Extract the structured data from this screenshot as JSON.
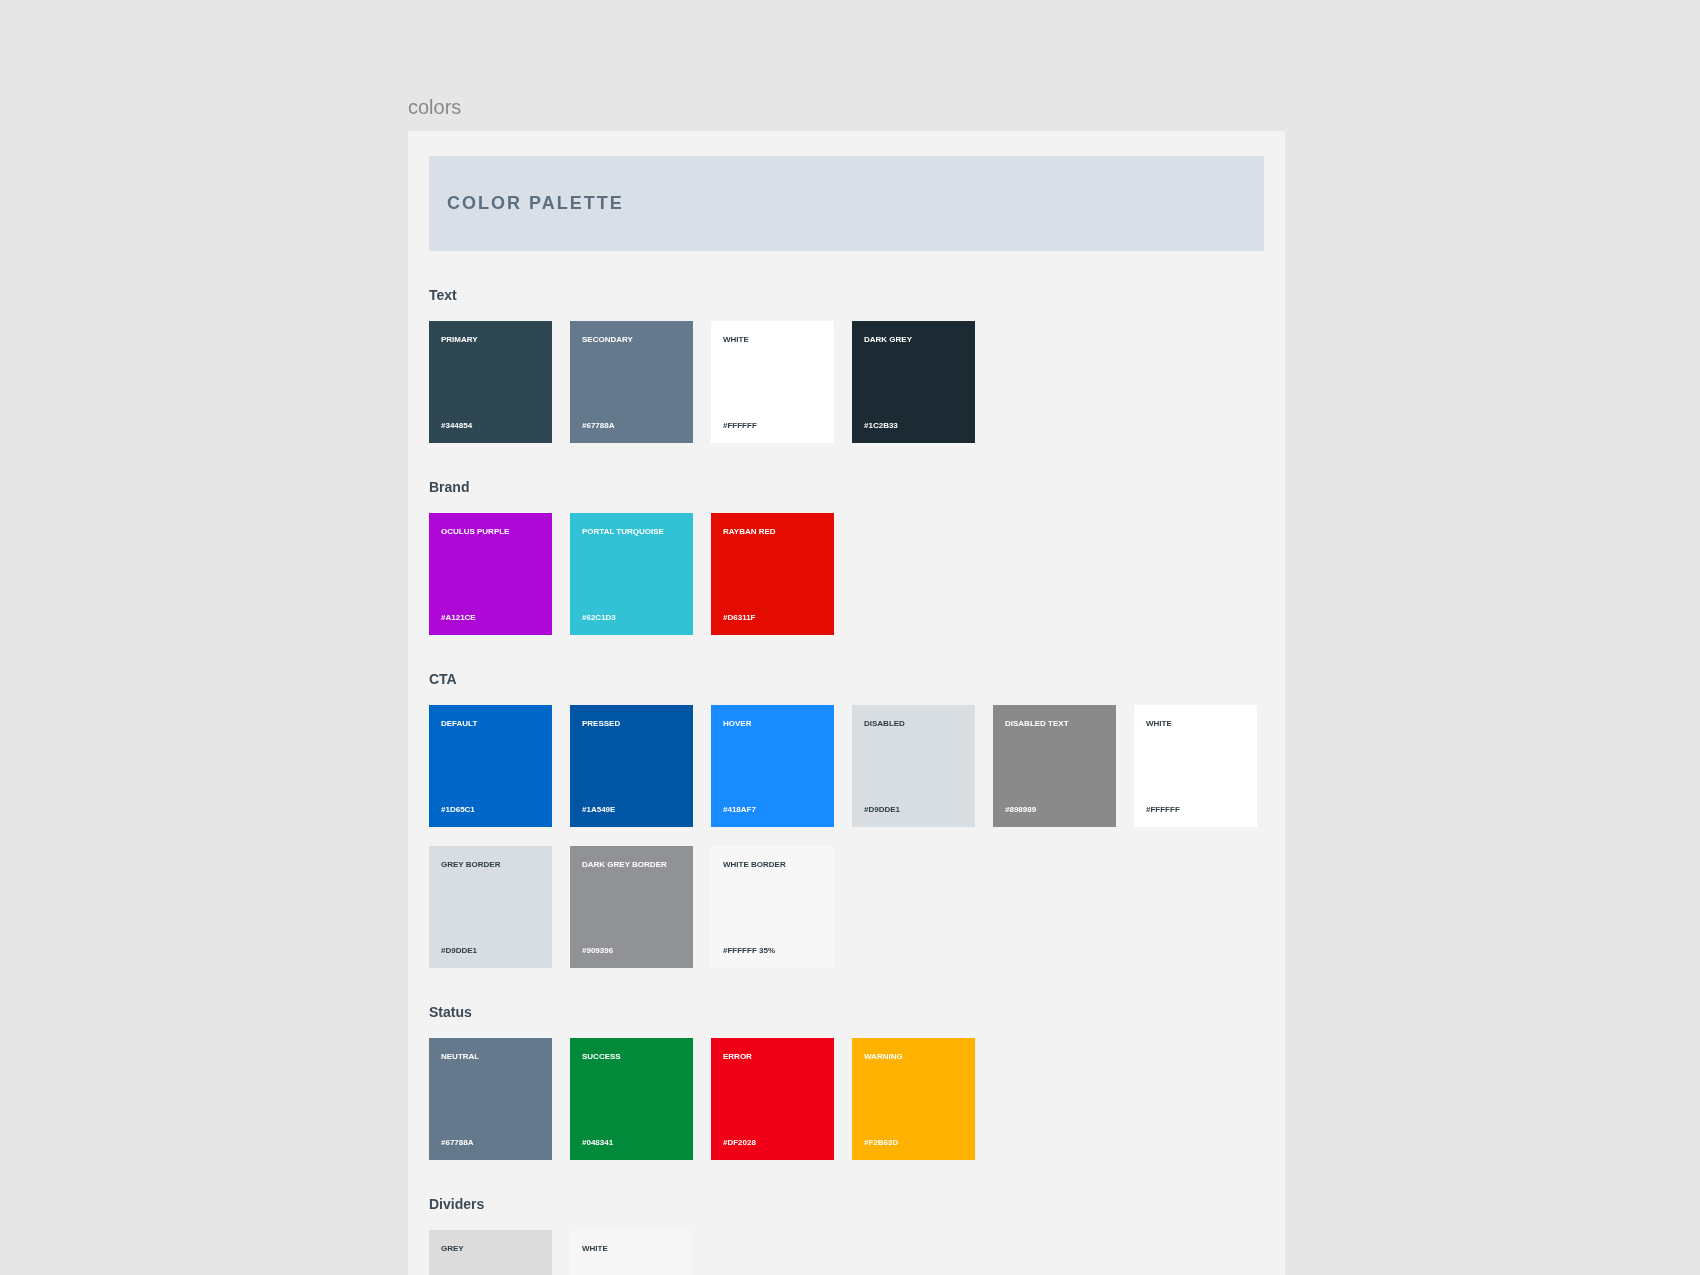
{
  "page_title": "colors",
  "header": {
    "title": "COLOR PALETTE"
  },
  "sections": [
    {
      "title": "Text",
      "rows": [
        [
          {
            "name": "PRIMARY",
            "hex": "#344854",
            "color": "#2e4753"
          },
          {
            "name": "SECONDARY",
            "hex": "#67788A",
            "color": "#647a8c"
          },
          {
            "name": "WHITE",
            "hex": "#FFFFFF",
            "color": "#ffffff"
          },
          {
            "name": "DARK GREY",
            "hex": "#1C2B33",
            "color": "#1c2b33"
          }
        ]
      ]
    },
    {
      "title": "Brand",
      "rows": [
        [
          {
            "name": "OCULUS PURPLE",
            "hex": "#A121CE",
            "color": "#ad08d5"
          },
          {
            "name": "PORTAL TURQUOISE",
            "hex": "#62C1D3",
            "color": "#31c2d6"
          },
          {
            "name": "RAYBAN RED",
            "hex": "#D6311F",
            "color": "#e40b00"
          }
        ]
      ]
    },
    {
      "title": "CTA",
      "rows": [
        [
          {
            "name": "DEFAULT",
            "hex": "#1D65C1",
            "color": "#0066c8"
          },
          {
            "name": "PRESSED",
            "hex": "#1A549E",
            "color": "#0155a5"
          },
          {
            "name": "HOVER",
            "hex": "#418AF7",
            "color": "#178bff"
          },
          {
            "name": "DISABLED",
            "hex": "#D9DDE1",
            "color": "#d8dde1"
          },
          {
            "name": "DISABLED TEXT",
            "hex": "#898989",
            "color": "#8a8a8a"
          },
          {
            "name": "WHITE",
            "hex": "#FFFFFF",
            "color": "#ffffff"
          }
        ],
        [
          {
            "name": "GREY BORDER",
            "hex": "#D9DDE1",
            "color": "#d8dde1"
          },
          {
            "name": "DARK GREY BORDER",
            "hex": "#909396",
            "color": "#909296"
          },
          {
            "name": "WHITE BORDER",
            "hex": "#FFFFFF 35%",
            "color": "#f7f7f7"
          }
        ]
      ]
    },
    {
      "title": "Status",
      "rows": [
        [
          {
            "name": "NEUTRAL",
            "hex": "#67788A",
            "color": "#647a8c"
          },
          {
            "name": "SUCCESS",
            "hex": "#048341",
            "color": "#018a3a"
          },
          {
            "name": "ERROR",
            "hex": "#DF2028",
            "color": "#f00017"
          },
          {
            "name": "WARNING",
            "hex": "#F2B63D",
            "color": "#ffb100"
          }
        ]
      ]
    },
    {
      "title": "Dividers",
      "rows": [
        [
          {
            "name": "GREY",
            "color": "#dcdcdc"
          },
          {
            "name": "WHITE",
            "color": "#f6f6f6"
          }
        ]
      ]
    }
  ]
}
